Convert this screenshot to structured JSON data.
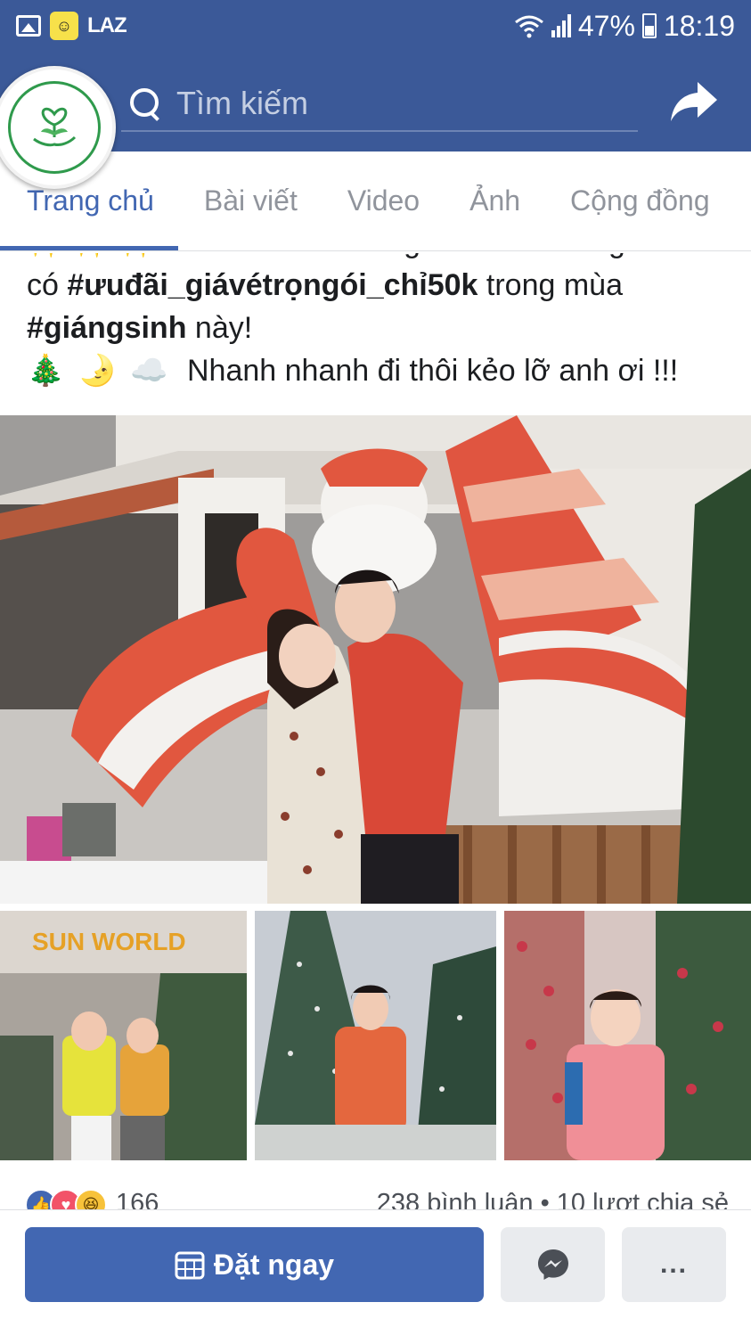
{
  "status_bar": {
    "app_badge": "LAZ",
    "battery": "47%",
    "time": "18:19"
  },
  "header": {
    "search_placeholder": "Tìm kiếm"
  },
  "tabs": [
    {
      "label": "Trang chủ"
    },
    {
      "label": "Bài viết"
    },
    {
      "label": "Video"
    },
    {
      "label": "Ảnh"
    },
    {
      "label": "Cộng đồng"
    }
  ],
  "post": {
    "line0": "✨ ✨ ✨ Sun World Danang Wonders đang",
    "line1_pre": "có ",
    "line1_tag": "#ưuđãi_giávétrọngói_chỉ50k",
    "line1_post": " trong mùa",
    "line2_tag": "#giángsinh",
    "line2_post": " này!",
    "line3_emojis": [
      "🎄",
      "🌛",
      "☁️"
    ],
    "line3_text": "Nhanh nhanh đi thôi kẻo lỡ anh ơi !!!"
  },
  "photos": {
    "sign_text": "SUN WORLD"
  },
  "reactions": {
    "count": "166",
    "stats": "238 bình luận • 10 lượt chia sẻ"
  },
  "bottom_bar": {
    "book_label": "Đặt ngay",
    "more_label": "..."
  },
  "colors": {
    "brand": "#3b5998",
    "button": "#4267b2"
  }
}
